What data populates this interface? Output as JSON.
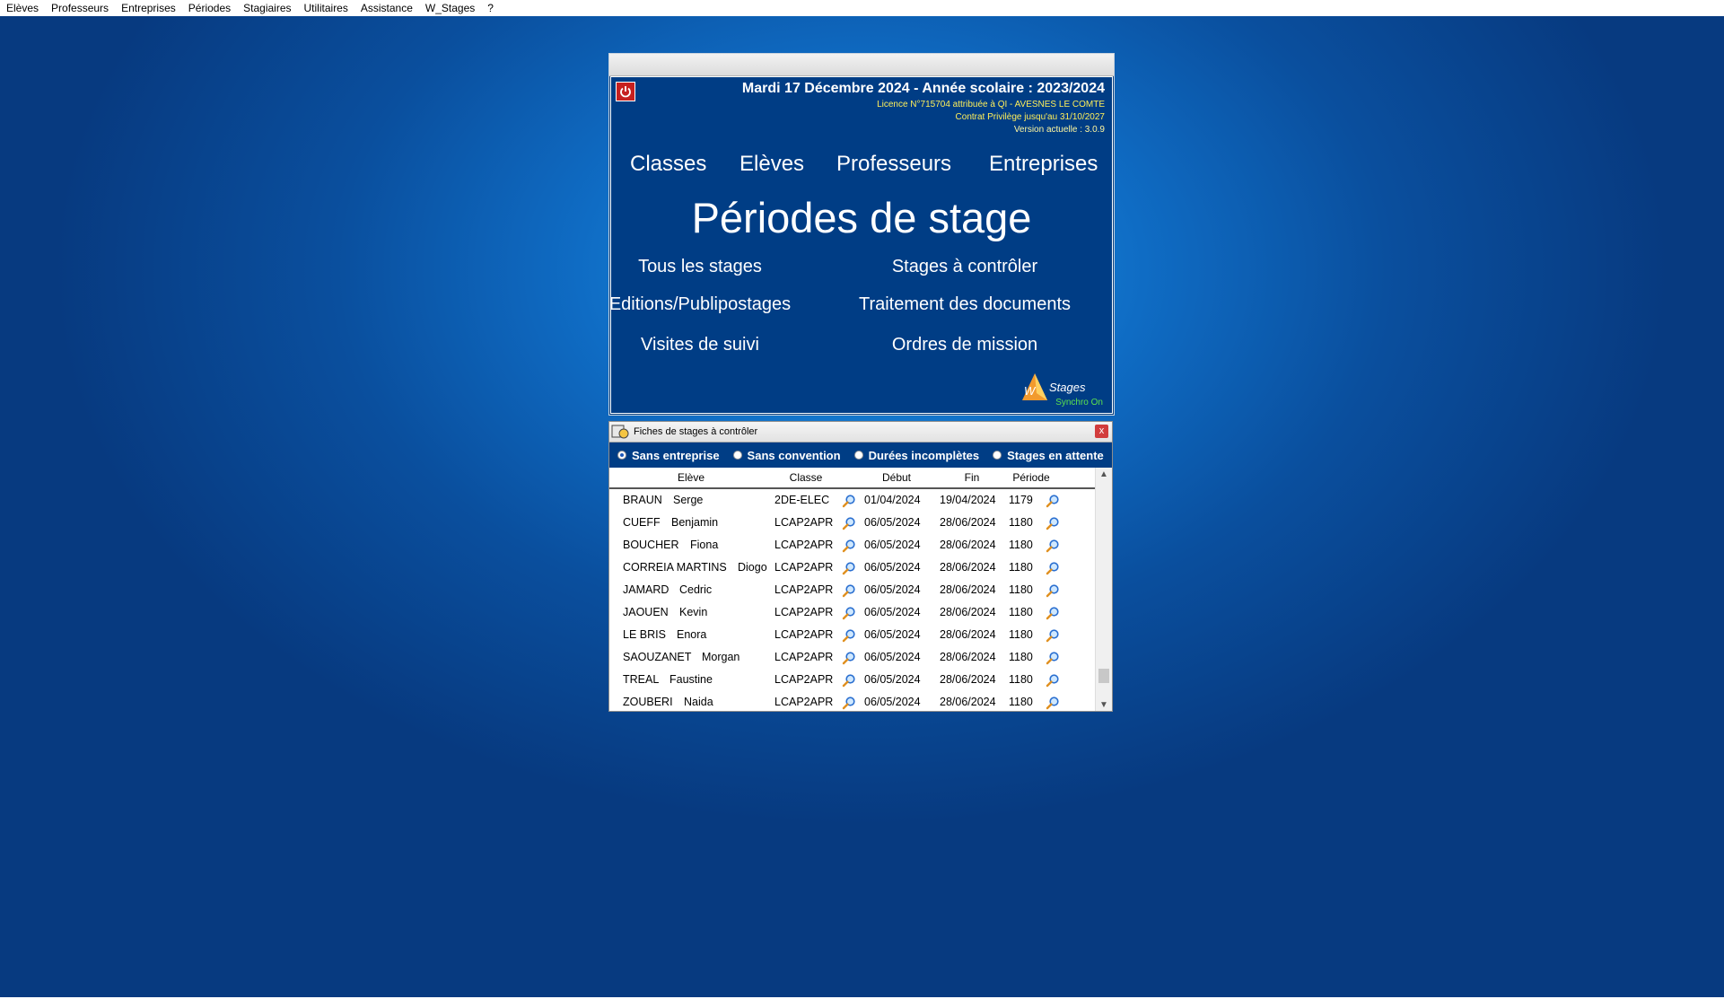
{
  "menu": [
    "Elèves",
    "Professeurs",
    "Entreprises",
    "Périodes",
    "Stagiaires",
    "Utilitaires",
    "Assistance",
    "W_Stages",
    "?"
  ],
  "header": {
    "date_line": "Mardi 17 Décembre 2024 - Année scolaire : 2023/2024",
    "licence": "Licence N°715704 attribuée à QI - AVESNES LE COMTE",
    "contrat": "Contrat Privilège jusqu'au 31/10/2027",
    "version": "Version actuelle : 3.0.9"
  },
  "nav": {
    "classes": "Classes",
    "eleves": "Elèves",
    "professeurs": "Professeurs",
    "entreprises": "Entreprises"
  },
  "title": "Périodes de stage",
  "links": {
    "tous": "Tous les stages",
    "controler": "Stages à contrôler",
    "editions": "Editions/Publipostages",
    "traitement": "Traitement des documents",
    "visites": "Visites de suivi",
    "ordres": "Ordres de mission"
  },
  "logo": {
    "text": "Stages",
    "synchro": "Synchro On"
  },
  "checker": {
    "title": "Fiches de stages à contrôler",
    "close": "x",
    "filters": [
      "Sans entreprise",
      "Sans convention",
      "Durées incomplètes",
      "Stages en attente"
    ],
    "selected_filter": "Sans entreprise",
    "columns": [
      "Elève",
      "Classe",
      "Début",
      "Fin",
      "Période"
    ],
    "rows": [
      {
        "nom": "BRAUN",
        "prenom": "Serge",
        "classe": "2DE-ELEC",
        "debut": "01/04/2024",
        "fin": "19/04/2024",
        "periode": "1179"
      },
      {
        "nom": "CUEFF",
        "prenom": "Benjamin",
        "classe": "LCAP2APR",
        "debut": "06/05/2024",
        "fin": "28/06/2024",
        "periode": "1180"
      },
      {
        "nom": "BOUCHER",
        "prenom": "Fiona",
        "classe": "LCAP2APR",
        "debut": "06/05/2024",
        "fin": "28/06/2024",
        "periode": "1180"
      },
      {
        "nom": "CORREIA MARTINS",
        "prenom": "Diogo",
        "classe": "LCAP2APR",
        "debut": "06/05/2024",
        "fin": "28/06/2024",
        "periode": "1180"
      },
      {
        "nom": "JAMARD",
        "prenom": "Cedric",
        "classe": "LCAP2APR",
        "debut": "06/05/2024",
        "fin": "28/06/2024",
        "periode": "1180"
      },
      {
        "nom": "JAOUEN",
        "prenom": "Kevin",
        "classe": "LCAP2APR",
        "debut": "06/05/2024",
        "fin": "28/06/2024",
        "periode": "1180"
      },
      {
        "nom": "LE BRIS",
        "prenom": "Enora",
        "classe": "LCAP2APR",
        "debut": "06/05/2024",
        "fin": "28/06/2024",
        "periode": "1180"
      },
      {
        "nom": "SAOUZANET",
        "prenom": "Morgan",
        "classe": "LCAP2APR",
        "debut": "06/05/2024",
        "fin": "28/06/2024",
        "periode": "1180"
      },
      {
        "nom": "TREAL",
        "prenom": "Faustine",
        "classe": "LCAP2APR",
        "debut": "06/05/2024",
        "fin": "28/06/2024",
        "periode": "1180"
      },
      {
        "nom": "ZOUBERI",
        "prenom": "Naida",
        "classe": "LCAP2APR",
        "debut": "06/05/2024",
        "fin": "28/06/2024",
        "periode": "1180"
      }
    ]
  },
  "colors": {
    "panel": "#003d85",
    "accent_yellow": "#ffef5a",
    "synchro_green": "#5de34e",
    "power_red": "#c62020"
  },
  "icons": [
    "power-icon",
    "search-icon",
    "wstages-logo-icon",
    "chevron-up-icon",
    "chevron-down-icon"
  ]
}
